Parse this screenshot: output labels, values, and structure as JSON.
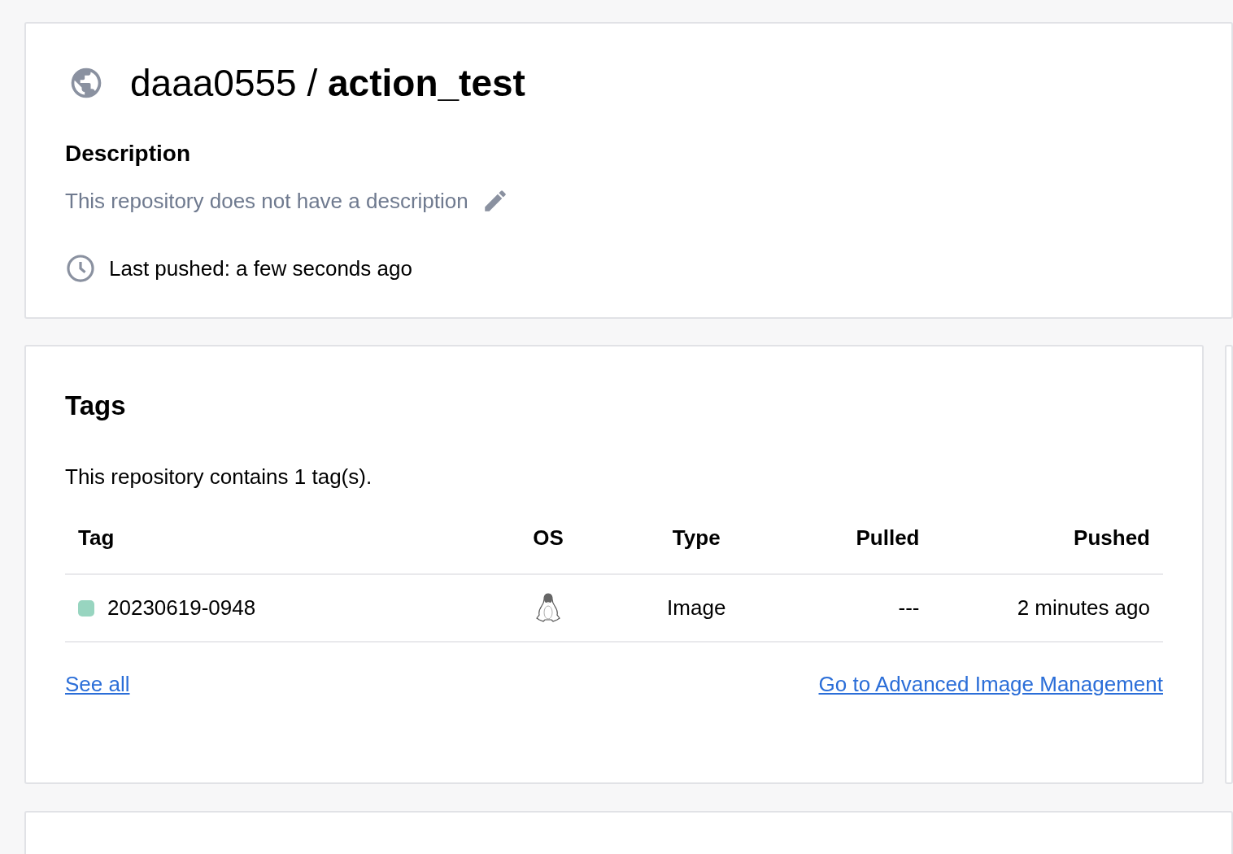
{
  "repository": {
    "namespace": "daaa0555",
    "separator": "/",
    "name": "action_test"
  },
  "description": {
    "heading": "Description",
    "text": "This repository does not have a description",
    "last_pushed": "Last pushed: a few seconds ago"
  },
  "tags": {
    "title": "Tags",
    "summary": "This repository contains 1 tag(s).",
    "columns": [
      "Tag",
      "OS",
      "Type",
      "Pulled",
      "Pushed"
    ],
    "rows": [
      {
        "tag": "20230619-0948",
        "color": "#98d5c0",
        "type": "Image",
        "pulled": "---",
        "pushed": "2 minutes ago"
      }
    ],
    "links": [
      "See all",
      "Go to Advanced Image Management"
    ]
  }
}
